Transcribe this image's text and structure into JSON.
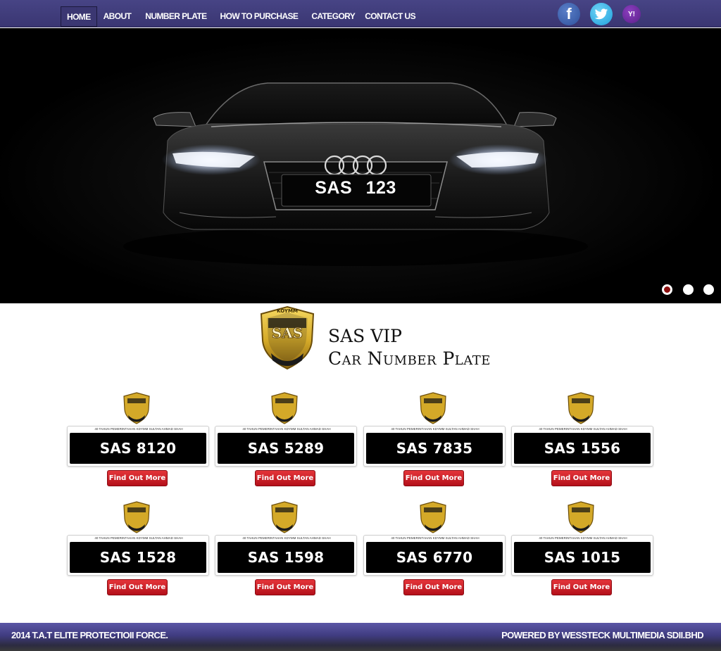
{
  "nav": {
    "items": [
      {
        "label": "HOME",
        "active": true
      },
      {
        "label": "ABOUT"
      },
      {
        "label": "NUMBER PLATE"
      },
      {
        "label": "HOW TO PURCHASE"
      },
      {
        "label": "CATEGORY"
      },
      {
        "label": "CONTACT US"
      }
    ],
    "social": [
      {
        "icon": "facebook-icon",
        "glyph": "f",
        "color": "#3b5998"
      },
      {
        "icon": "twitter-icon",
        "glyph": "🐦",
        "color": "#1da1f2"
      },
      {
        "icon": "yahoo-icon",
        "glyph": "Y!",
        "color": "#6a1b9a"
      }
    ]
  },
  "hero": {
    "plate_text": "SAS 123",
    "slides": 3,
    "active_slide": 1
  },
  "brand": {
    "logo_text": "SAS",
    "logo_top": "KOYMM",
    "title_line1": "SAS VIP",
    "title_line2": "Car Number Plate"
  },
  "plates": {
    "tagline": "40 TAHUN PEMERINTAHAN KDYMM SULTAN AHMAD SHAH",
    "button_label": "Find Out More",
    "items": [
      "SAS 8120",
      "SAS 5289",
      "SAS 7835",
      "SAS 1556",
      "SAS 1528",
      "SAS 1598",
      "SAS 6770",
      "SAS 1015"
    ]
  },
  "footer": {
    "left": "2014 T.A.T ELITE PROTECTIOII FORCE.",
    "right": "POWERED BY WESSTECK MULTIMEDIA SDII.BHD"
  },
  "colors": {
    "nav_bg": "#3f3b7a",
    "button_red": "#c8161f",
    "gold": "#d4a928"
  }
}
